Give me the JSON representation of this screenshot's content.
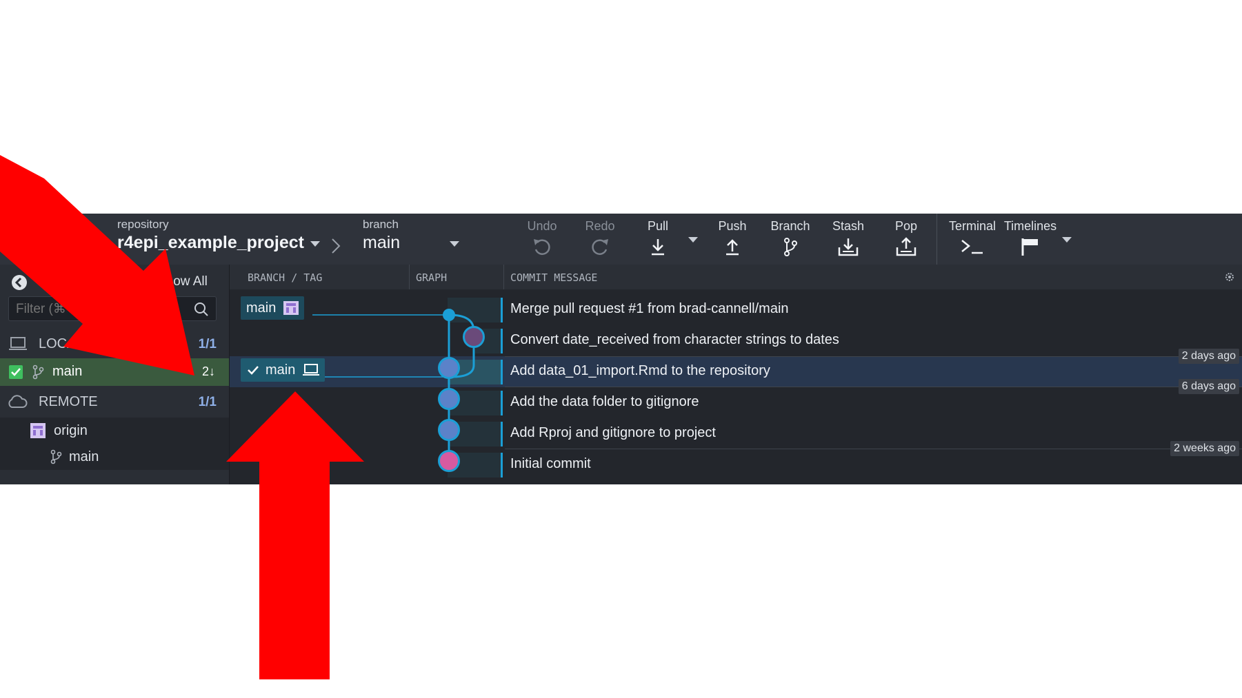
{
  "toolbar": {
    "repository_caption": "repository",
    "repository_name": "r4epi_example_project",
    "branch_caption": "branch",
    "branch_name": "main",
    "buttons": {
      "undo": "Undo",
      "redo": "Redo",
      "pull": "Pull",
      "push": "Push",
      "branch": "Branch",
      "stash": "Stash",
      "pop": "Pop",
      "terminal": "Terminal",
      "timelines": "Timelines"
    }
  },
  "sidebar": {
    "show_all": "Show All",
    "filter_placeholder": "Filter (⌘",
    "local_label": "LOCAL",
    "local_count": "1/1",
    "local_branch": "main",
    "local_branch_behind": "2↓",
    "remote_label": "REMOTE",
    "remote_count": "1/1",
    "remote_origin": "origin",
    "remote_branch": "main"
  },
  "columns": {
    "branch_tag": "BRANCH / TAG",
    "graph": "GRAPH",
    "commit_message": "COMMIT MESSAGE"
  },
  "commits": [
    {
      "message": "Merge pull request #1 from brad-cannell/main",
      "tag": "main"
    },
    {
      "message": "Convert date_received from character strings to dates"
    },
    {
      "message": "Add data_01_import.Rmd to the repository",
      "tag": "main"
    },
    {
      "message": "Add the data folder to gitignore"
    },
    {
      "message": "Add Rproj and gitignore to project"
    },
    {
      "message": "Initial commit"
    }
  ],
  "time_badges": [
    "2 days ago",
    "6 days ago",
    "2 weeks ago"
  ],
  "colors": {
    "accent": "#1b9fd6",
    "annotation_arrow": "#ff0000",
    "selected_row": "#28374f"
  }
}
